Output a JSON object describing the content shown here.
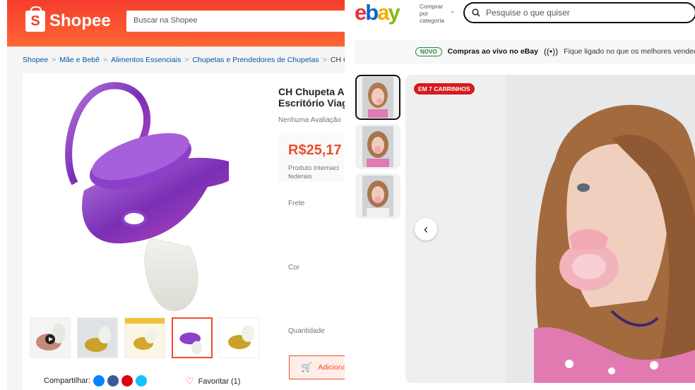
{
  "shopee": {
    "logo_text": "Shopee",
    "search_placeholder": "Buscar na Shopee",
    "breadcrumb": [
      "Shopee",
      "Mãe e Bebê",
      "Alimentos Essenciais",
      "Chupetas e Prendedores de Chupetas"
    ],
    "breadcrumb_current": "CH Chupeta Ad",
    "title_line1": "CH Chupeta A",
    "title_line2": "Escritório Viag",
    "rating": "Nenhuma Avaliação",
    "price": "R$25,17",
    "intl_note": "Produto internaci federais",
    "labels": {
      "frete": "Frete",
      "cor": "Cor",
      "quantidade": "Quantidade"
    },
    "add_to_cart": "Adicionar",
    "share": "Compartilhar:",
    "favorite": "Favoritar (1)",
    "colors": {
      "brand": "#ee4d2d",
      "header": "#f53d2d",
      "link": "#0055aa"
    }
  },
  "ebay": {
    "logo": [
      "e",
      "b",
      "a",
      "y"
    ],
    "logo_colors": [
      "#e53238",
      "#0064d2",
      "#f5af02",
      "#86b817"
    ],
    "category_text": "Comprar por categoria",
    "search_placeholder": "Pesquise o que quiser",
    "banner_badge": "NOVO",
    "banner_title": "Compras ao vivo no eBay",
    "banner_rest": "Fique ligado no que os melhores vendedo",
    "cart_badge": "EM 7 CARRINHOS"
  }
}
